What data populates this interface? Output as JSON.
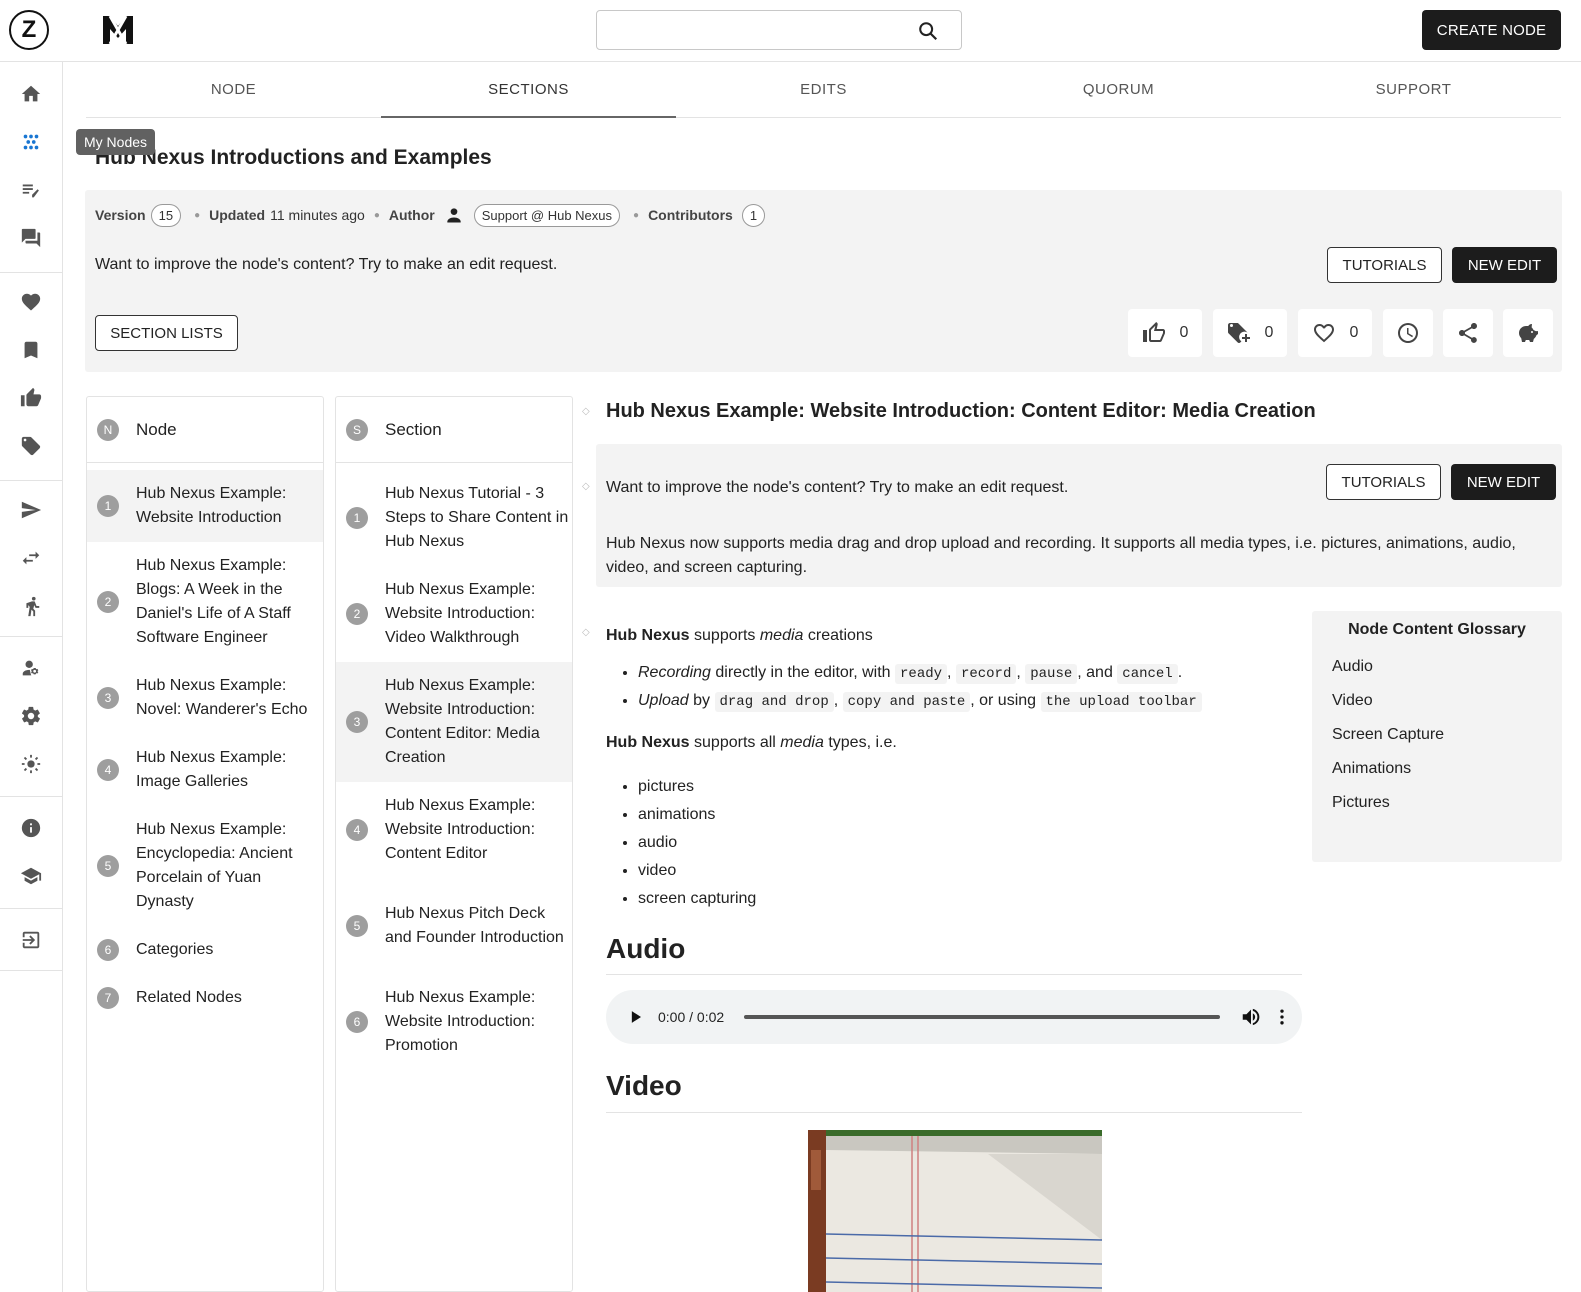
{
  "header": {
    "logo_letter": "Z",
    "search_placeholder": "",
    "create_button": "CREATE NODE"
  },
  "sidebar": {
    "tooltip": "My Nodes",
    "icons": [
      "home-icon",
      "my-nodes-icon",
      "edit-list-icon",
      "chat-icon",
      "heart-icon",
      "bookmark-icon",
      "thumb-up-icon",
      "tag-icon",
      "send-icon",
      "swap-icon",
      "person-running-icon",
      "manage-accounts-icon",
      "settings-icon",
      "brightness-icon",
      "info-icon",
      "school-icon",
      "logout-icon"
    ]
  },
  "tabs": [
    "NODE",
    "SECTIONS",
    "EDITS",
    "QUORUM",
    "SUPPORT"
  ],
  "active_tab": "SECTIONS",
  "node": {
    "title": "Hub Nexus Introductions and Examples",
    "version_label": "Version",
    "version": "15",
    "updated_label": "Updated",
    "updated": "11 minutes ago",
    "author_label": "Author",
    "author": "Support @ Hub Nexus",
    "contributors_label": "Contributors",
    "contributors": "1",
    "improve_text": "Want to improve the node's content? Try to make an edit request.",
    "tutorials_btn": "TUTORIALS",
    "new_edit_btn": "NEW EDIT",
    "section_lists_btn": "SECTION LISTS",
    "likes": "0",
    "tags": "0",
    "favorites": "0"
  },
  "node_panel": {
    "badge": "N",
    "header": "Node",
    "items": [
      {
        "n": "1",
        "label": "Hub Nexus Example: Website Introduction"
      },
      {
        "n": "2",
        "label": "Hub Nexus Example: Blogs: A Week in the Daniel's Life of A Staff Software Engineer"
      },
      {
        "n": "3",
        "label": "Hub Nexus Example: Novel: Wanderer's Echo"
      },
      {
        "n": "4",
        "label": "Hub Nexus Example: Image Galleries"
      },
      {
        "n": "5",
        "label": "Hub Nexus Example: Encyclopedia: Ancient Porcelain of Yuan Dynasty"
      },
      {
        "n": "6",
        "label": "Categories"
      },
      {
        "n": "7",
        "label": "Related Nodes"
      }
    ]
  },
  "section_panel": {
    "badge": "S",
    "header": "Section",
    "items": [
      {
        "n": "1",
        "label": "Hub Nexus Tutorial - 3 Steps to Share Content in Hub Nexus"
      },
      {
        "n": "2",
        "label": "Hub Nexus Example: Website Introduction: Video Walkthrough"
      },
      {
        "n": "3",
        "label": "Hub Nexus Example: Website Introduction: Content Editor: Media Creation"
      },
      {
        "n": "4",
        "label": "Hub Nexus Example: Website Introduction: Content Editor"
      },
      {
        "n": "5",
        "label": "Hub Nexus Pitch Deck and Founder Introduction"
      },
      {
        "n": "6",
        "label": "Hub Nexus Example: Website Introduction: Promotion"
      }
    ]
  },
  "section": {
    "title": "Hub Nexus Example: Website Introduction: Content Editor: Media Creation",
    "improve_text": "Want to improve the node's content? Try to make an edit request.",
    "tutorials_btn": "TUTORIALS",
    "new_edit_btn": "NEW EDIT",
    "description": "Hub Nexus now supports media drag and drop upload and recording. It supports all media types, i.e. pictures, animations, audio, video, and screen capturing.",
    "p1": {
      "brand": "Hub Nexus",
      "t1": " supports ",
      "em": "media",
      "t2": " creations"
    },
    "b1": {
      "em": "Recording",
      "t1": " directly in the editor, with ",
      "c1": "ready",
      "s1": ", ",
      "c2": "record",
      "s2": ", ",
      "c3": "pause",
      "s3": ", and ",
      "c4": "cancel",
      "end": "."
    },
    "b2": {
      "em": "Upload",
      "t1": " by ",
      "c1": "drag and drop",
      "s1": ", ",
      "c2": "copy and paste",
      "s2": ", or using ",
      "c3": "the upload toolbar"
    },
    "p2": {
      "brand": "Hub Nexus",
      "t1": " supports all ",
      "em": "media",
      "t2": " types, i.e."
    },
    "types": [
      "pictures",
      "animations",
      "audio",
      "video",
      "screen capturing"
    ],
    "audio_heading": "Audio",
    "audio_time": "0:00 / 0:02",
    "video_heading": "Video"
  },
  "glossary": {
    "title": "Node Content Glossary",
    "items": [
      "Audio",
      "Video",
      "Screen Capture",
      "Animations",
      "Pictures"
    ]
  }
}
